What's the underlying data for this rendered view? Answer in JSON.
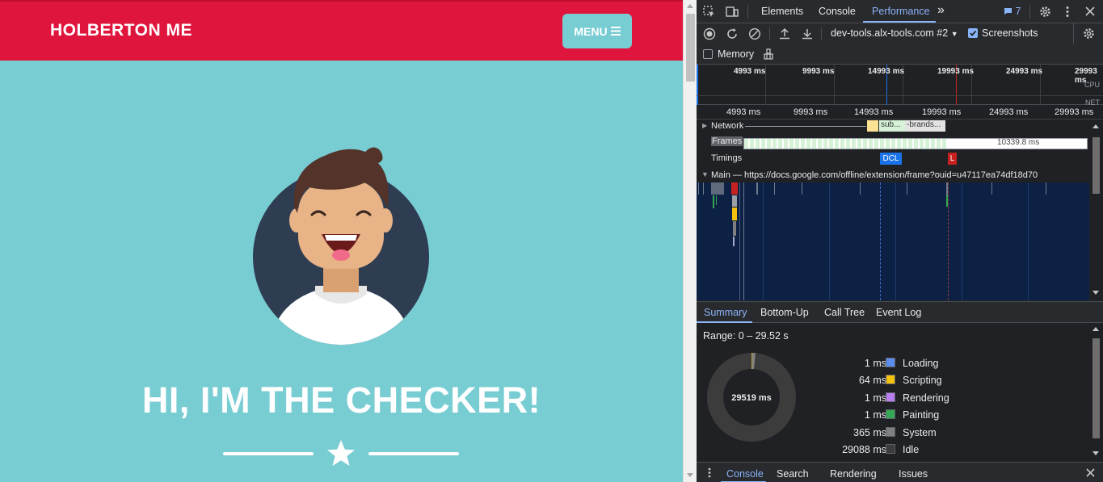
{
  "site": {
    "brand": "HOLBERTON ME",
    "menu_label": "MENU",
    "hero_title": "HI, I'M THE CHECKER!",
    "colors": {
      "header": "#e0153e",
      "background": "#78cdd2"
    }
  },
  "devtools": {
    "tabs": [
      "Elements",
      "Console",
      "Performance"
    ],
    "active_tab": "Performance",
    "more_tabs": "»",
    "message_count": "7",
    "target": "dev-tools.alx-tools.com #2",
    "screenshots_label": "Screenshots",
    "screenshots_checked": true,
    "memory_label": "Memory",
    "memory_checked": false,
    "overview_ticks": [
      "4993 ms",
      "9993 ms",
      "14993 ms",
      "19993 ms",
      "24993 ms",
      "29993 ms"
    ],
    "overview_cpu": "CPU",
    "overview_net": "NET",
    "ruler_ticks": [
      "4993 ms",
      "9993 ms",
      "14993 ms",
      "19993 ms",
      "24993 ms",
      "29993 ms"
    ],
    "network_label": "Network",
    "network_items": [
      "sub...",
      "-brands..."
    ],
    "frames_label": "Frames",
    "frames_time": "10339.8 ms",
    "timings_label": "Timings",
    "dcl_label": "DCL",
    "l_label": "L",
    "main_label": "Main — https://docs.google.com/offline/extension/frame?ouid=u47117ea74df18d70",
    "summary_tabs": [
      "Summary",
      "Bottom-Up",
      "Call Tree",
      "Event Log"
    ],
    "active_summary_tab": "Summary",
    "range": "Range: 0 – 29.52 s",
    "total": "29519 ms",
    "breakdown": [
      {
        "name": "Loading",
        "value": "1 ms",
        "ms": 1,
        "color": "#5b8def"
      },
      {
        "name": "Scripting",
        "value": "64 ms",
        "ms": 64,
        "color": "#f4c20d"
      },
      {
        "name": "Rendering",
        "value": "1 ms",
        "ms": 1,
        "color": "#b87ef0"
      },
      {
        "name": "Painting",
        "value": "1 ms",
        "ms": 1,
        "color": "#34a853"
      },
      {
        "name": "System",
        "value": "365 ms",
        "ms": 365,
        "color": "#808080"
      },
      {
        "name": "Idle",
        "value": "29088 ms",
        "ms": 29088,
        "color": "#3c3c3c"
      }
    ],
    "drawer_tabs": [
      "Console",
      "Search",
      "Rendering",
      "Issues"
    ],
    "active_drawer_tab": "Console"
  }
}
